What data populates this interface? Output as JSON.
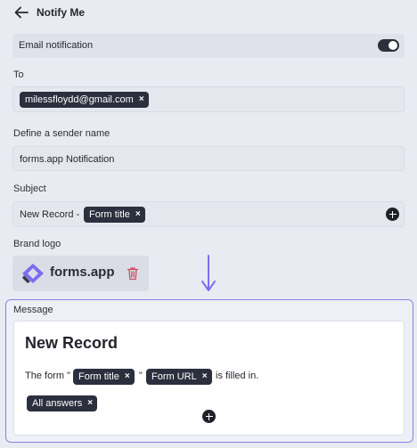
{
  "header": {
    "title": "Notify Me"
  },
  "email_notification": {
    "label": "Email notification",
    "enabled": true
  },
  "to": {
    "label": "To",
    "recipients": [
      "milessfloydd@gmail.com"
    ]
  },
  "sender": {
    "label": "Define a sender name",
    "value": "forms.app Notification"
  },
  "subject": {
    "label": "Subject",
    "prefix": "New Record -",
    "token": "Form title"
  },
  "brand_logo": {
    "label": "Brand logo",
    "logo_text": "forms.app"
  },
  "message": {
    "label": "Message",
    "heading": "New Record",
    "text_before": "The form \"",
    "token_form_title": "Form title",
    "quote_mid": "\"",
    "token_form_url": "Form URL",
    "text_after": "is filled in.",
    "token_all_answers": "All answers"
  },
  "chip_close_glyph": "×",
  "colors": {
    "accent": "#8b80e8",
    "chip": "#2c2f3d",
    "background": "#e9ebf2"
  }
}
